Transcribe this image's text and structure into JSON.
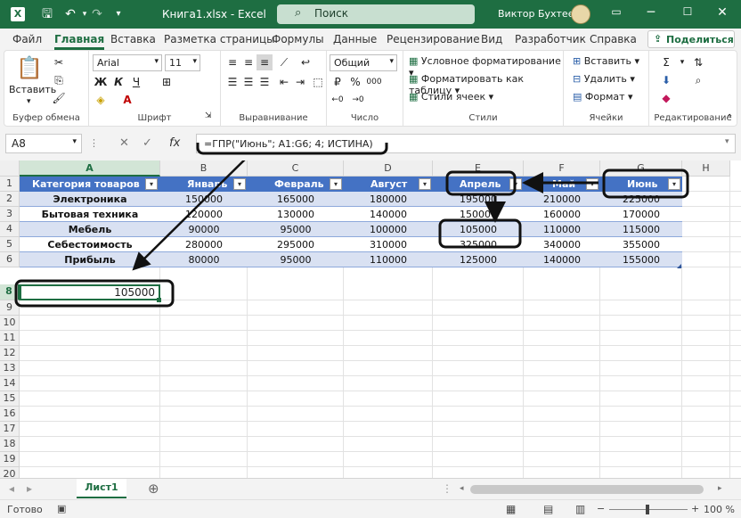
{
  "window": {
    "title": "Книга1.xlsx  -  Excel",
    "search_placeholder": "Поиск",
    "user_name": "Виктор Бухтеев",
    "icons": {
      "excel": "excel-logo-icon",
      "save": "save-icon",
      "undo": "undo-icon",
      "redo": "redo-icon",
      "more": "customize-icon"
    }
  },
  "menu": {
    "tabs": [
      "Файл",
      "Главная",
      "Вставка",
      "Разметка страницы",
      "Формулы",
      "Данные",
      "Рецензирование",
      "Вид",
      "Разработчик",
      "Справка"
    ],
    "active": "Главная",
    "share_label": "Поделиться"
  },
  "ribbon": {
    "clipboard": {
      "paste": "Вставить",
      "label": "Буфер обмена"
    },
    "font": {
      "name": "Arial",
      "size": "11",
      "bold": "Ж",
      "italic": "К",
      "underline": "Ч",
      "grow": "A^",
      "shrink": "Aˇ",
      "label": "Шрифт"
    },
    "alignment": {
      "label": "Выравнивание"
    },
    "number": {
      "format": "Общий",
      "percent": "%",
      "thousands": "000",
      "label": "Число"
    },
    "styles": {
      "conditional": "Условное форматирование",
      "as_table": "Форматировать как таблицу",
      "cell_styles": "Стили ячеек",
      "label": "Стили"
    },
    "cells": {
      "insert": "Вставить",
      "delete": "Удалить",
      "format": "Формат",
      "label": "Ячейки"
    },
    "editing": {
      "label": "Редактирование"
    }
  },
  "formula_bar": {
    "name_box": "A8",
    "formula": "=ГПР(\"Июнь\"; A1:G6; 4; ИСТИНА)"
  },
  "sheet": {
    "columns": [
      "A",
      "B",
      "C",
      "D",
      "E",
      "F",
      "G",
      "H"
    ],
    "rows": [
      "1",
      "2",
      "3",
      "4",
      "5",
      "6",
      "7",
      "8",
      "9",
      "10",
      "11",
      "12",
      "13",
      "14",
      "15",
      "16",
      "17",
      "18",
      "19",
      "20"
    ],
    "header_row": [
      "Категория товаров",
      "Январь",
      "Февраль",
      "Август",
      "Апрель",
      "Май",
      "Июнь"
    ],
    "data": [
      [
        "Электроника",
        "150000",
        "165000",
        "180000",
        "195000",
        "210000",
        "225000"
      ],
      [
        "Бытовая техника",
        "120000",
        "130000",
        "140000",
        "150000",
        "160000",
        "170000"
      ],
      [
        "Мебель",
        "90000",
        "95000",
        "100000",
        "105000",
        "110000",
        "115000"
      ],
      [
        "Себестоимость",
        "280000",
        "295000",
        "310000",
        "325000",
        "340000",
        "355000"
      ],
      [
        "Прибыль",
        "80000",
        "95000",
        "110000",
        "125000",
        "140000",
        "155000"
      ]
    ],
    "selected_cell_value": "105000",
    "table_header_color": "#4472c4",
    "band_color": "#d9e1f2"
  },
  "sheet_tabs": {
    "active": "Лист1"
  },
  "status": {
    "text": "Готово",
    "zoom": "100 %"
  }
}
